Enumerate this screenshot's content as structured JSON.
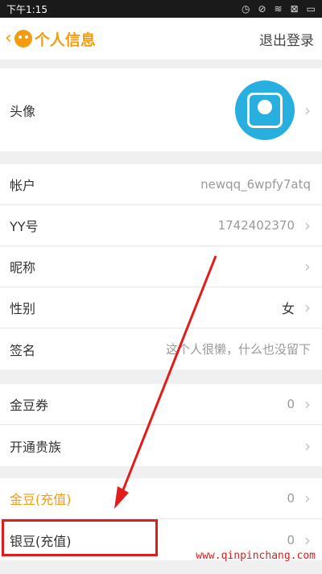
{
  "status_bar": {
    "time": "下午1:15"
  },
  "header": {
    "title": "个人信息",
    "logout": "退出登录"
  },
  "avatar_row": {
    "label": "头像"
  },
  "account_rows": [
    {
      "label": "帐户",
      "value": "newqq_6wpfy7atq"
    },
    {
      "label": "YY号",
      "value": "1742402370"
    },
    {
      "label": "昵称",
      "value": ""
    },
    {
      "label": "性别",
      "value": "女"
    },
    {
      "label": "签名",
      "value": "这个人很懒，什么也没留下"
    }
  ],
  "coupon_rows": [
    {
      "label": "金豆券",
      "value": "0"
    },
    {
      "label": "开通贵族",
      "value": ""
    }
  ],
  "bean_rows": [
    {
      "label": "金豆(充值)",
      "value": "0"
    },
    {
      "label": "银豆(充值)",
      "value": "0"
    }
  ],
  "watermark": "www.qinpinchang.com",
  "colors": {
    "accent": "#f39c12",
    "avatar": "#29aee0",
    "annotation": "#e21b1b"
  }
}
